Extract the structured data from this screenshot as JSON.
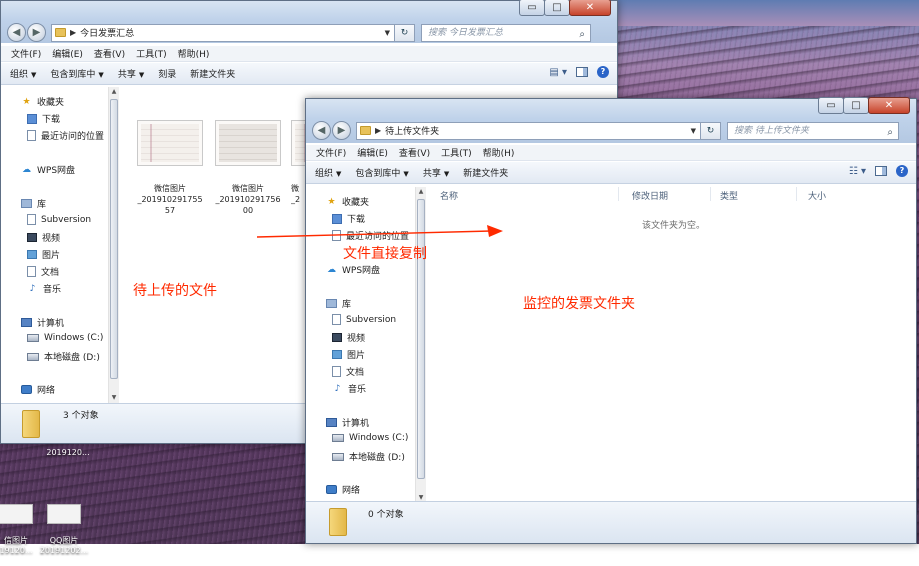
{
  "desktop": {
    "icons": [
      {
        "label": "2019120..."
      },
      {
        "label": "信图片\n19120..."
      },
      {
        "label": "QQ图片\n20191202..."
      }
    ]
  },
  "win1": {
    "address": "今日发票汇总",
    "search_placeholder": "搜索 今日发票汇总",
    "menu": [
      "文件(F)",
      "编辑(E)",
      "查看(V)",
      "工具(T)",
      "帮助(H)"
    ],
    "toolbar": {
      "organize": "组织",
      "include": "包含到库中",
      "share": "共享",
      "burn": "刻录",
      "new_folder": "新建文件夹"
    },
    "nav": {
      "favorites": "收藏夹",
      "downloads": "下载",
      "recent": "最近访问的位置",
      "wps": "WPS网盘",
      "libraries": "库",
      "subversion": "Subversion",
      "videos": "视频",
      "pictures": "图片",
      "documents": "文档",
      "music": "音乐",
      "computer": "计算机",
      "drive_c": "Windows (C:)",
      "drive_d": "本地磁盘 (D:)",
      "network": "网络"
    },
    "files": [
      {
        "name": "微信图片\n_201910291755\n57"
      },
      {
        "name": "微信图片\n_201910291756\n00"
      },
      {
        "name": "微\n_2"
      }
    ],
    "status": "3 个对象"
  },
  "win2": {
    "address": "待上传文件夹",
    "search_placeholder": "搜索 待上传文件夹",
    "menu": [
      "文件(F)",
      "编辑(E)",
      "查看(V)",
      "工具(T)",
      "帮助(H)"
    ],
    "toolbar": {
      "organize": "组织",
      "include": "包含到库中",
      "share": "共享",
      "new_folder": "新建文件夹"
    },
    "columns": [
      "名称",
      "修改日期",
      "类型",
      "大小"
    ],
    "empty_message": "该文件夹为空。",
    "nav": {
      "favorites": "收藏夹",
      "downloads": "下载",
      "recent": "最近访问的位置",
      "wps": "WPS网盘",
      "libraries": "库",
      "subversion": "Subversion",
      "videos": "视频",
      "pictures": "图片",
      "documents": "文档",
      "music": "音乐",
      "computer": "计算机",
      "drive_c": "Windows (C:)",
      "drive_d": "本地磁盘 (D:)",
      "network": "网络"
    },
    "status": "0 个对象"
  },
  "annotations": {
    "left_label": "待上传的文件",
    "arrow_label": "文件直接复制",
    "right_label": "监控的发票文件夹",
    "color": "#ff2a00"
  }
}
